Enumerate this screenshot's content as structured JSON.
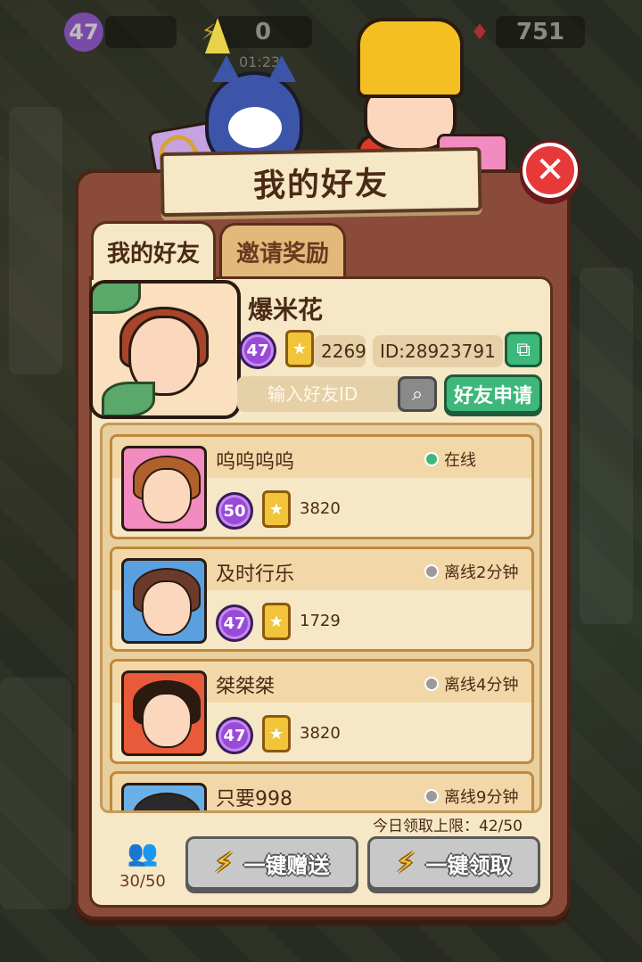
{
  "topbar": {
    "level": "47",
    "energy": "0",
    "energy_timer": "01:23",
    "gems": "751"
  },
  "dialog": {
    "title": "我的好友",
    "close_icon": "✕"
  },
  "tabs": [
    {
      "label": "我的好友",
      "active": true
    },
    {
      "label": "邀请奖励",
      "active": false
    }
  ],
  "profile": {
    "name": "爆米花",
    "level": "47",
    "score": "2269",
    "id_text": "ID:28923791"
  },
  "search": {
    "placeholder": "输入好友ID",
    "apply_label": "好友申请"
  },
  "friends": [
    {
      "name": "呜呜呜呜",
      "level": "50",
      "score": "3820",
      "status": "在线",
      "online": true
    },
    {
      "name": "及时行乐",
      "level": "47",
      "score": "1729",
      "status": "离线2分钟",
      "online": false
    },
    {
      "name": "桀桀桀",
      "level": "47",
      "score": "3820",
      "status": "离线4分钟",
      "online": false
    },
    {
      "name": "只要998",
      "level": "",
      "score": "",
      "status": "离线9分钟",
      "online": false
    }
  ],
  "footer": {
    "limit_text": "今日领取上限：42/50",
    "friend_count": "30/50",
    "send_all_label": "一键赠送",
    "claim_all_label": "一键领取"
  },
  "colors": {
    "online": "#3db87a",
    "offline": "#9a9a9a",
    "panel": "#8a4b3a",
    "content": "#f6e7c6"
  }
}
